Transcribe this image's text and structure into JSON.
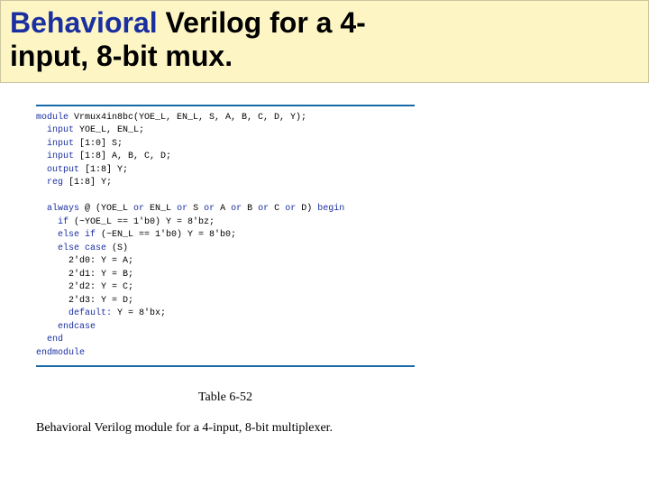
{
  "title": {
    "accent": "Behavioral",
    "rest1": " Verilog for a 4-",
    "rest2": "input, 8-bit mux."
  },
  "code": {
    "kw_module": "module",
    "l1": " Vrmux4in8bc(YOE_L, EN_L, S, A, B, C, D, Y);",
    "kw_input1": "  input",
    "l2": " YOE_L, EN_L;",
    "kw_input2": "  input",
    "l3": " [1:0] S;",
    "kw_input3": "  input",
    "l4": " [1:8] A, B, C, D;",
    "kw_output": "  output",
    "l5": " [1:8] Y;",
    "kw_reg": "  reg",
    "l6": " [1:8] Y;",
    "kw_always": "  always",
    "l7_a": " @ (YOE_L ",
    "kw_or1": "or",
    "l7_b": " EN_L ",
    "kw_or2": "or",
    "l7_c": " S ",
    "kw_or3": "or",
    "l7_d": " A ",
    "kw_or4": "or",
    "l7_e": " B ",
    "kw_or5": "or",
    "l7_f": " C ",
    "kw_or6": "or",
    "l7_g": " D) ",
    "kw_begin": "begin",
    "kw_if": "    if",
    "l8": " (~YOE_L == 1'b0) Y = 8'bz;",
    "kw_elseif": "    else if",
    "l9": " (~EN_L == 1'b0) Y = 8'b0;",
    "kw_elsecase": "    else case",
    "l10": " (S)",
    "l11": "      2'd0: Y = A;",
    "l12": "      2'd1: Y = B;",
    "l13": "      2'd2: Y = C;",
    "l14": "      2'd3: Y = D;",
    "kw_default": "      default:",
    "l15": " Y = 8'bx;",
    "kw_endcase": "    endcase",
    "kw_end": "  end",
    "kw_endmodule": "endmodule"
  },
  "caption": {
    "table_label": "Table 6-52",
    "text": "Behavioral Verilog module for a 4-input, 8-bit multiplexer."
  }
}
